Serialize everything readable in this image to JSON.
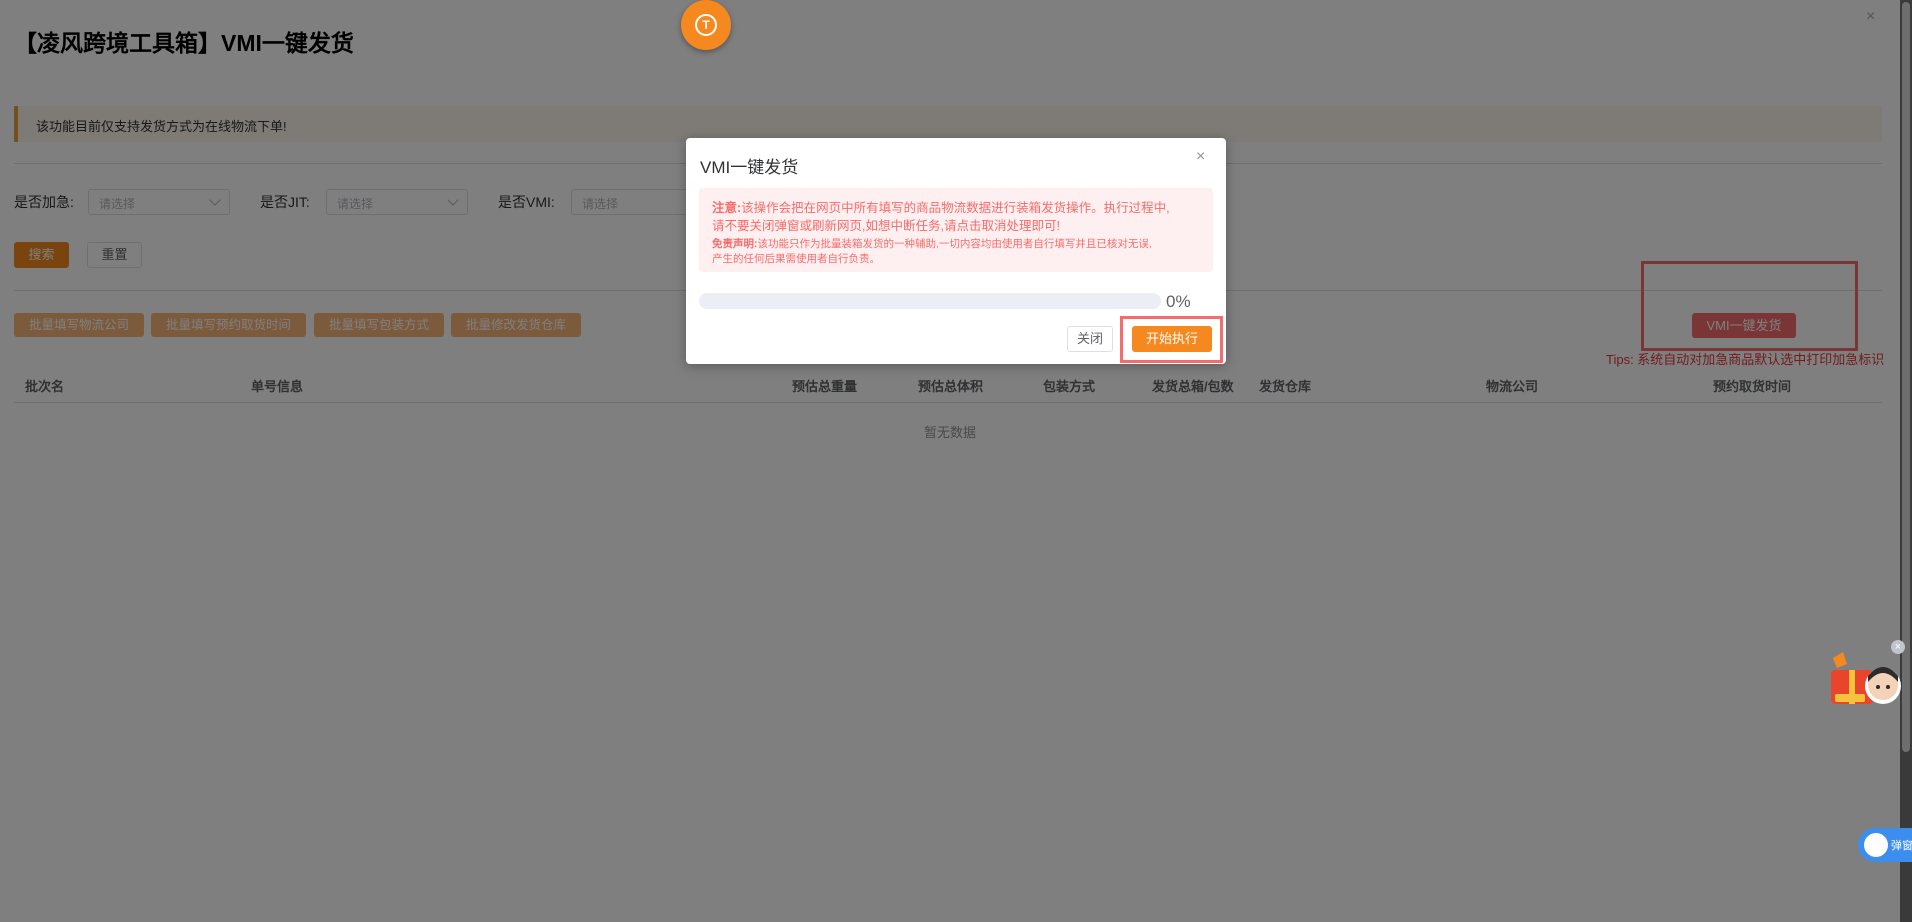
{
  "page": {
    "title": "【凌风跨境工具箱】VMI一键发货",
    "alert": "该功能目前仅支持发货方式为在线物流下单!",
    "close_glyph": "×"
  },
  "filters": [
    {
      "label": "是否加急:",
      "placeholder": "请选择"
    },
    {
      "label": "是否JIT:",
      "placeholder": "请选择"
    },
    {
      "label": "是否VMI:",
      "placeholder": "请选择"
    }
  ],
  "actions": {
    "search": "搜索",
    "reset": "重置"
  },
  "batch_buttons": [
    "批量填写物流公司",
    "批量填写预约取货时间",
    "批量填写包装方式",
    "批量修改发货仓库"
  ],
  "vmi_button": "VMI一键发货",
  "tips": "Tips: 系统自动对加急商品默认选中打印加急标识",
  "table": {
    "headers": [
      "批次名",
      "单号信息",
      "预估总重量",
      "预估总体积",
      "包装方式",
      "发货总箱/包数",
      "发货仓库",
      "物流公司",
      "预约取货时间"
    ],
    "empty_text": "暂无数据"
  },
  "top_badge_glyph": "T",
  "dialog": {
    "title": "VMI一键发货",
    "close_glyph": "×",
    "notice_label": "注意:",
    "notice_line1": "该操作会把在网页中所有填写的商品物流数据进行装箱发货操作。执行过程中,",
    "notice_line2": "请不要关闭弹窗或刷新网页,如想中断任务,请点击取消处理即可!",
    "disclaimer_label": "免责声明:",
    "disclaimer_line1": "该功能只作为批量装箱发货的一种辅助,一切内容均由使用者自行填写并且已核对无误,",
    "disclaimer_line2": "产生的任何后果需使用者自行负责。",
    "progress_percent": 0,
    "progress_text": "0%",
    "close_button": "关闭",
    "start_button": "开始执行"
  },
  "side_widgets": {
    "chat_close_glyph": "×",
    "popup_label": "弹窗"
  },
  "colors": {
    "accent": "#f5891f",
    "danger": "#f56c6c",
    "info_blue": "#3b8eed"
  }
}
